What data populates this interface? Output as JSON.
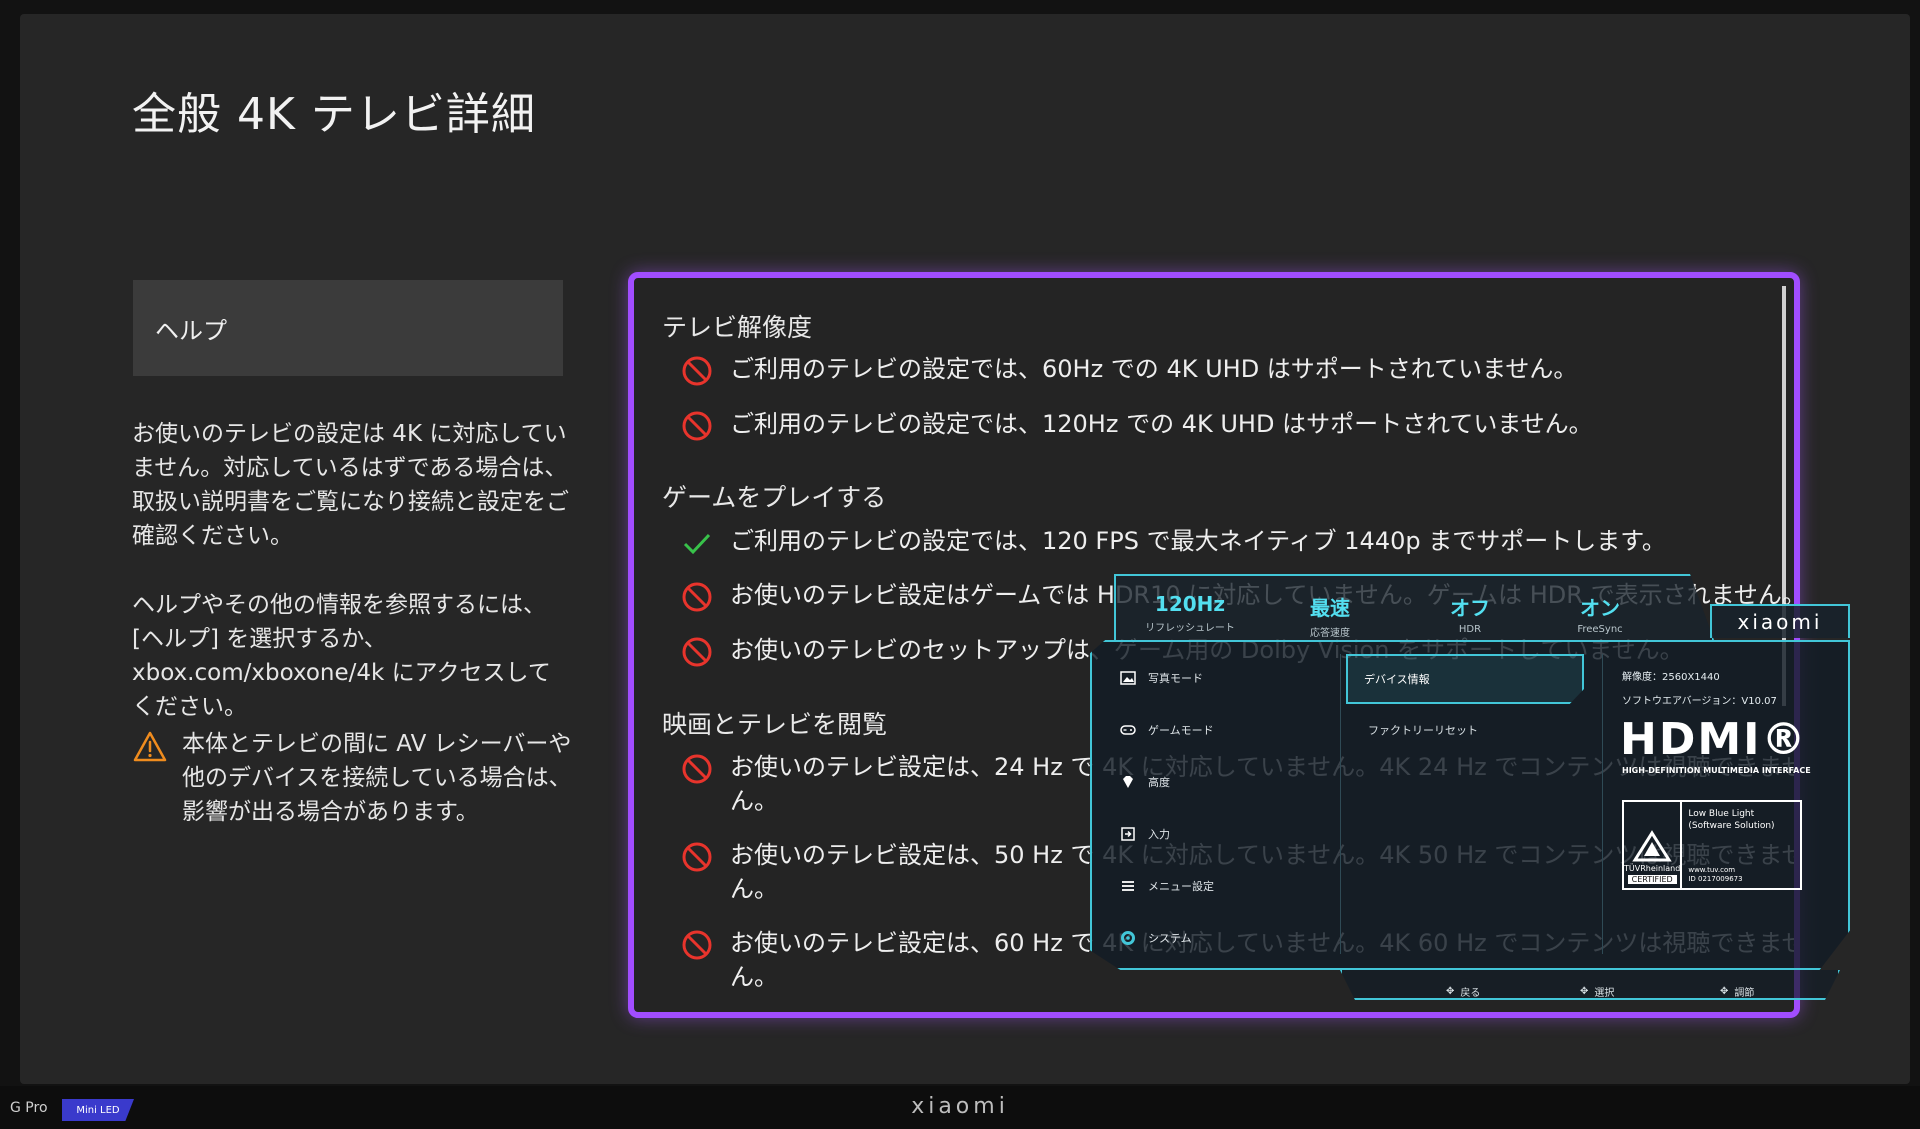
{
  "page": {
    "title": "全般 4K テレビ詳細"
  },
  "sidebar": {
    "help_label": "ヘルプ",
    "para1": "お使いのテレビの設定は 4K に対応していません。対応しているはずである場合は、取扱い説明書をご覧になり接続と設定をご確認ください。",
    "para2": "ヘルプやその他の情報を参照するには、[ヘルプ] を選択するか、xbox.com/xboxone/4k にアクセスしてください。",
    "warning": "本体とテレビの間に AV レシーバーや他のデバイスを接続している場合は、影響が出る場合があります。",
    "warning_icon": "warning-triangle-icon"
  },
  "panel": {
    "section_resolution": "テレビ解像度",
    "res_60": "ご利用のテレビの設定では、60Hz での 4K UHD はサポートされていません。",
    "res_120": "ご利用のテレビの設定では、120Hz での 4K UHD はサポートされていません。",
    "section_game": "ゲームをプレイする",
    "game_fps": "ご利用のテレビの設定では、120 FPS で最大ネイティブ 1440p までサポートします。",
    "game_hdr": "お使いのテレビ設定はゲームでは HDR10 に対応していません。ゲームは HDR で表示されません。",
    "game_dv": "お使いのテレビのセットアップは、ゲーム用の Dolby Vision をサポートしていません。",
    "section_movie": "映画とテレビを閲覧",
    "movie_24_a": "お使いのテレビ設定は、24 Hz で 4K に対応していません。4K 24 Hz でコンテンツは視聴できませ",
    "movie_24_b": "ん。",
    "movie_50_a": "お使いのテレビ設定は、50 Hz で 4K に対応していません。4K 50 Hz でコンテンツは視聴できませ",
    "movie_50_b": "ん。",
    "movie_60_a": "お使いのテレビ設定は、60 Hz で 4K に対応していません。4K 60 Hz でコンテンツは視聴できませ",
    "movie_60_b": "ん。",
    "status_colors": {
      "error": "#e8342c",
      "ok": "#38c24a",
      "warning": "#f08c1e",
      "focus": "#a14dff"
    }
  },
  "osd": {
    "stat1_value": "120Hz",
    "stat1_label": "リフレッシュレート",
    "stat2_value": "最速",
    "stat2_label": "応答速度",
    "stat3_value": "オフ",
    "stat3_label": "HDR",
    "stat4_value": "オン",
    "stat4_label": "FreeSync",
    "brand": "xiaomi",
    "menu_photo": "写真モード",
    "menu_game": "ゲームモード",
    "menu_advanced": "高度",
    "menu_input": "入力",
    "menu_settings": "メニュー設定",
    "menu_system": "システム",
    "selected": "デバイス情報",
    "factory_reset": "ファクトリーリセット",
    "resolution": "解像度：2560X1440",
    "firmware": "ソフトウエアバージョン：V10.07",
    "hdmi_logo": "HDMI®",
    "hdmi_sub": "HIGH-DEFINITION MULTIMEDIA INTERFACE",
    "tuv_name": "TÜVRheinland",
    "tuv_certified": "CERTIFIED",
    "tuv_desc": "Low Blue Light (Software Solution)",
    "tuv_url": "www.tuv.com",
    "tuv_id": "ID 0217009673",
    "foot_back": "戻る",
    "foot_select": "選択",
    "foot_adjust": "調節",
    "accent": "#42c6d8"
  },
  "bezel": {
    "logo": "xiaomi",
    "model": "G Pro",
    "badge": "Mini LED"
  }
}
